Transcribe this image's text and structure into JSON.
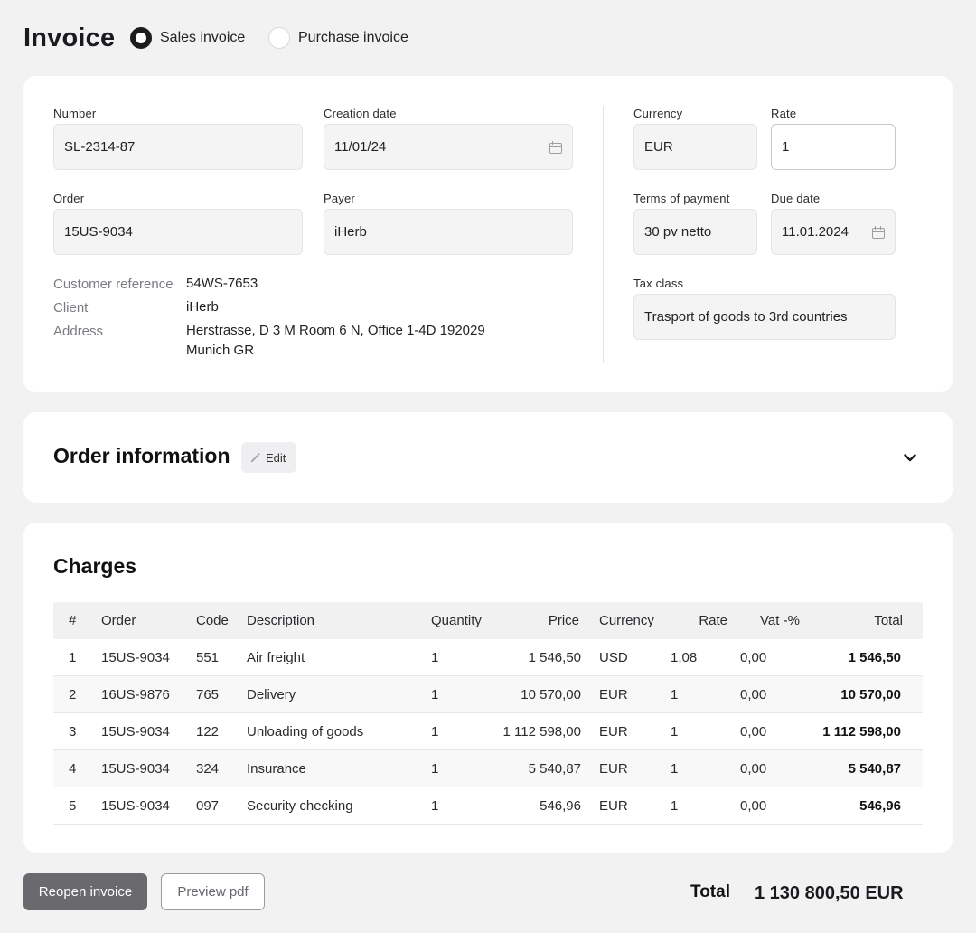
{
  "header": {
    "title": "Invoice",
    "type_options": [
      {
        "label": "Sales invoice",
        "checked": true
      },
      {
        "label": "Purchase invoice",
        "checked": false
      }
    ]
  },
  "details": {
    "number": {
      "label": "Number",
      "value": "SL-2314-87"
    },
    "creation_date": {
      "label": "Creation date",
      "value": "11/01/24",
      "icon": "calendar-icon"
    },
    "order": {
      "label": "Order",
      "value": "15US-9034"
    },
    "payer": {
      "label": "Payer",
      "value": "iHerb"
    },
    "info": [
      {
        "key": "Customer reference",
        "value": "54WS-7653"
      },
      {
        "key": "Client",
        "value": "iHerb"
      },
      {
        "key": "Address",
        "value_lines": [
          "Herstrasse, D 3 M Room 6 N, Office 1-4D 192029",
          "Munich GR"
        ]
      }
    ],
    "currency": {
      "label": "Currency",
      "value": "EUR"
    },
    "rate": {
      "label": "Rate",
      "value": "1"
    },
    "terms_of_payment": {
      "label": "Terms of payment",
      "value": "30 pv netto"
    },
    "due_date": {
      "label": "Due date",
      "value": "11.01.2024",
      "icon": "calendar-icon"
    },
    "tax_class": {
      "label": "Tax class",
      "value": "Trasport of goods to 3rd countries"
    }
  },
  "order_information": {
    "title": "Order information",
    "edit_label": "Edit",
    "icons": [
      "pencil-icon",
      "chevron-down-icon"
    ]
  },
  "charges": {
    "title": "Charges",
    "columns": [
      "#",
      "Order",
      "Code",
      "Description",
      "Quantity",
      "Price",
      "Currency",
      "Rate",
      "Vat -%",
      "Total"
    ],
    "rows": [
      [
        "1",
        "15US-9034",
        "551",
        "Air freight",
        "1",
        "1 546,50",
        "USD",
        "1,08",
        "0,00",
        "1 546,50"
      ],
      [
        "2",
        "16US-9876",
        "765",
        "Delivery",
        "1",
        "10 570,00",
        "EUR",
        "1",
        "0,00",
        "10 570,00"
      ],
      [
        "3",
        "15US-9034",
        "122",
        "Unloading of goods",
        "1",
        "1 112 598,00",
        "EUR",
        "1",
        "0,00",
        "1 112 598,00"
      ],
      [
        "4",
        "15US-9034",
        "324",
        "Insurance",
        "1",
        "5 540,87",
        "EUR",
        "1",
        "0,00",
        "5 540,87"
      ],
      [
        "5",
        "15US-9034",
        "097",
        "Security checking",
        "1",
        "546,96",
        "EUR",
        "1",
        "0,00",
        "546,96"
      ]
    ]
  },
  "footer": {
    "reopen_label": "Reopen invoice",
    "preview_label": "Preview pdf",
    "total_label": "Total",
    "total_value": "1 130 800,50 EUR"
  },
  "colors": {
    "page_bg": "#f2f2f3",
    "card_bg": "#ffffff",
    "primary_button": "#6a6a6e",
    "text": "#1b1b1f"
  }
}
